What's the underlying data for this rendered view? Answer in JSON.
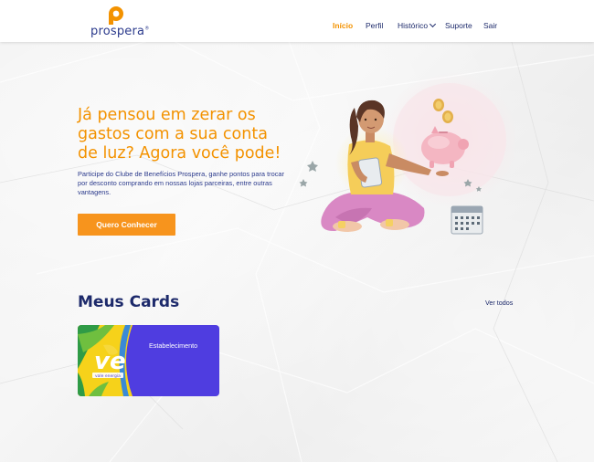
{
  "brand": {
    "name": "prospera",
    "mark_letter": "p",
    "registered": "®"
  },
  "nav": {
    "items": [
      {
        "label": "Início",
        "active": true
      },
      {
        "label": "Perfil",
        "active": false
      },
      {
        "label": "Histórico",
        "active": false,
        "dropdown": true
      },
      {
        "label": "Suporte",
        "active": false
      },
      {
        "label": "Sair",
        "active": false
      }
    ]
  },
  "hero": {
    "title_lines": [
      "Já pensou em zerar os",
      "gastos com a sua conta",
      "de luz? Agora você pode!"
    ],
    "description": "Participe do Clube de Benefícios Prospera, ganhe pontos para trocar por desconto comprando em nossas lojas parceiras, entre outras vantagens.",
    "cta_label": "Quero Conhecer"
  },
  "cards_section": {
    "title": "Meus Cards",
    "see_all_label": "Ver todos",
    "cards": [
      {
        "label": "Estabelecimento",
        "logo_text": "ve",
        "logo_tagline": "vale energia"
      }
    ]
  },
  "colors": {
    "accent": "#f39200",
    "cta": "#f7941d",
    "navy": "#1d2a6b",
    "card_bg": "#4f3de0",
    "card_yellow": "#f6d21a"
  },
  "icons": {
    "logo_mark": "prospera-p-logo",
    "illustration": "woman-with-piggy-bank-illustration",
    "dropdown": "chevron-down-icon"
  }
}
